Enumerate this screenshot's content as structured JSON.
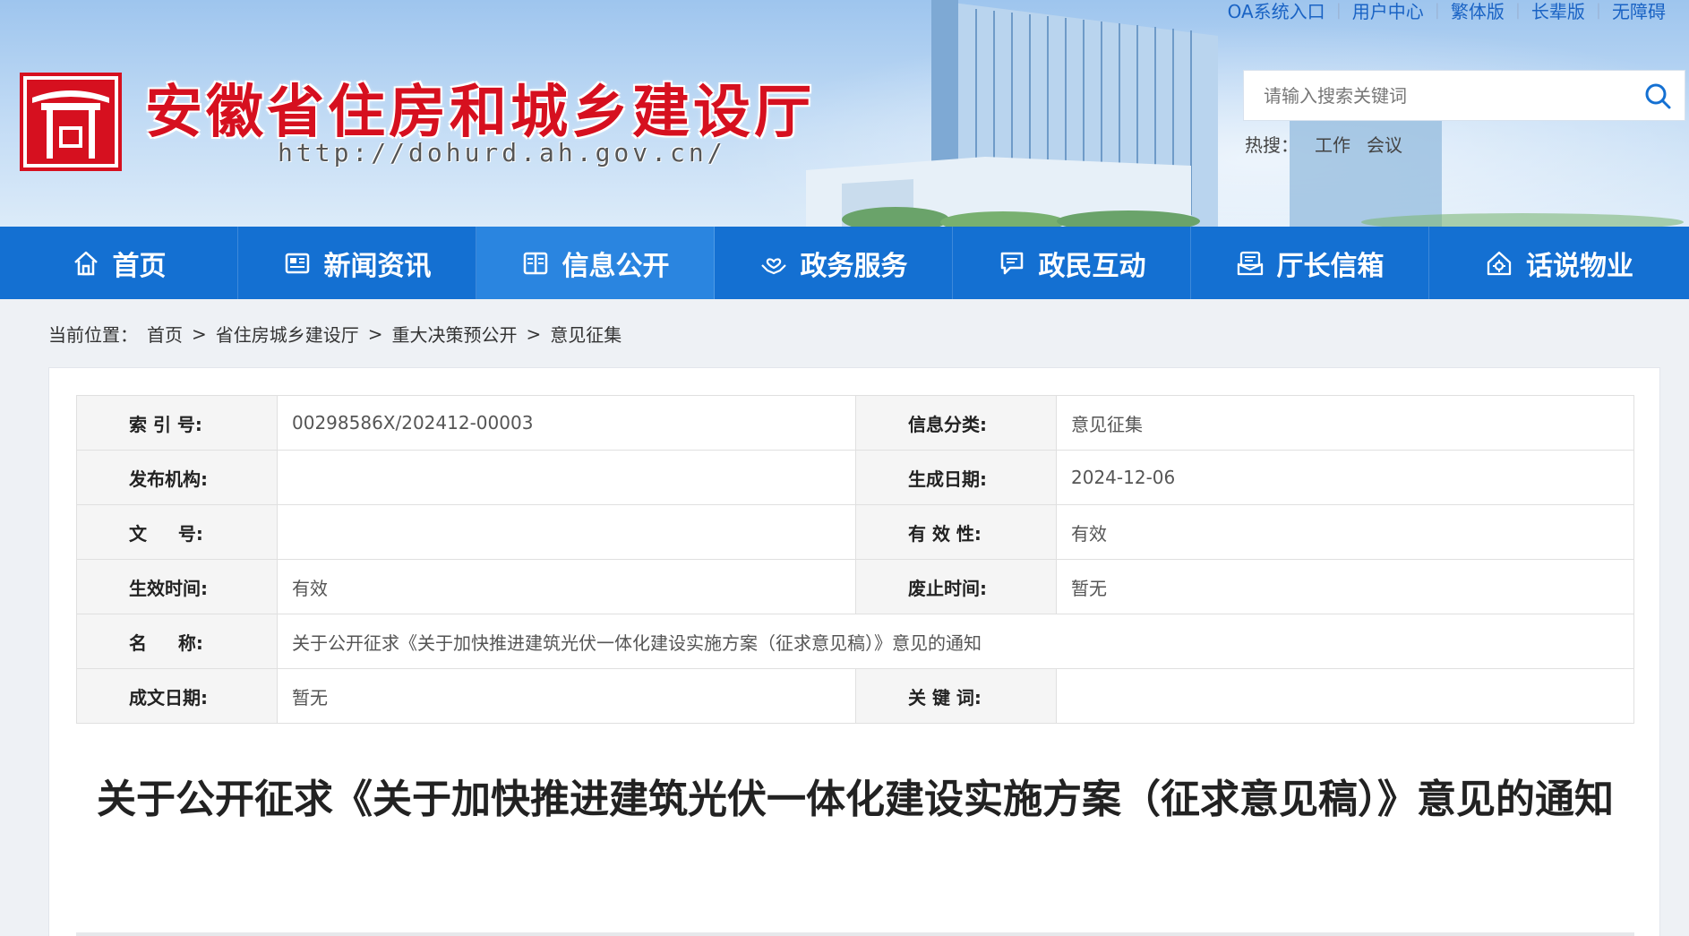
{
  "top_links": [
    "OA系统入口",
    "用户中心",
    "繁体版",
    "长辈版",
    "无障碍"
  ],
  "site": {
    "name": "安徽省住房和城乡建设厅",
    "url": "http://dohurd.ah.gov.cn/"
  },
  "search": {
    "placeholder": "请输入搜索关键词",
    "hot_label": "热搜：",
    "hot_words": [
      "工作",
      "会议"
    ]
  },
  "nav": [
    {
      "label": "首页",
      "icon": "home-icon"
    },
    {
      "label": "新闻资讯",
      "icon": "newspaper-icon"
    },
    {
      "label": "信息公开",
      "icon": "book-icon"
    },
    {
      "label": "政务服务",
      "icon": "hands-heart-icon"
    },
    {
      "label": "政民互动",
      "icon": "chat-icon"
    },
    {
      "label": "厅长信箱",
      "icon": "mailbox-icon"
    },
    {
      "label": "话说物业",
      "icon": "house-gear-icon"
    }
  ],
  "nav_active_index": 2,
  "breadcrumb": {
    "prefix": "当前位置：",
    "items": [
      "首页",
      "省住房城乡建设厅",
      "重大决策预公开",
      "意见征集"
    ],
    "separator": ">"
  },
  "meta": {
    "index_no_label": "索 引 号:",
    "index_no": "00298586X/202412-00003",
    "category_label": "信息分类:",
    "category": "意见征集",
    "publisher_label": "发布机构:",
    "publisher": "",
    "created_label": "生成日期:",
    "created": "2024-12-06",
    "doc_no_label": "文     号:",
    "doc_no": "",
    "validity_label": "有 效 性:",
    "validity": "有效",
    "effective_label": "生效时间:",
    "effective": "有效",
    "expiry_label": "废止时间:",
    "expiry": "暂无",
    "name_label": "名     称:",
    "name": "关于公开征求《关于加快推进建筑光伏一体化建设实施方案（征求意见稿）》意见的通知",
    "written_label": "成文日期:",
    "written": "暂无",
    "keywords_label": "关 键 词:",
    "keywords": ""
  },
  "article": {
    "title": "关于公开征求《关于加快推进建筑光伏一体化建设实施方案（征求意见稿）》意见的通知"
  },
  "colors": {
    "nav_bg": "#1470d2",
    "nav_active": "#2a85e0",
    "brand_red": "#d6101f",
    "link_blue": "#1a63c4"
  }
}
